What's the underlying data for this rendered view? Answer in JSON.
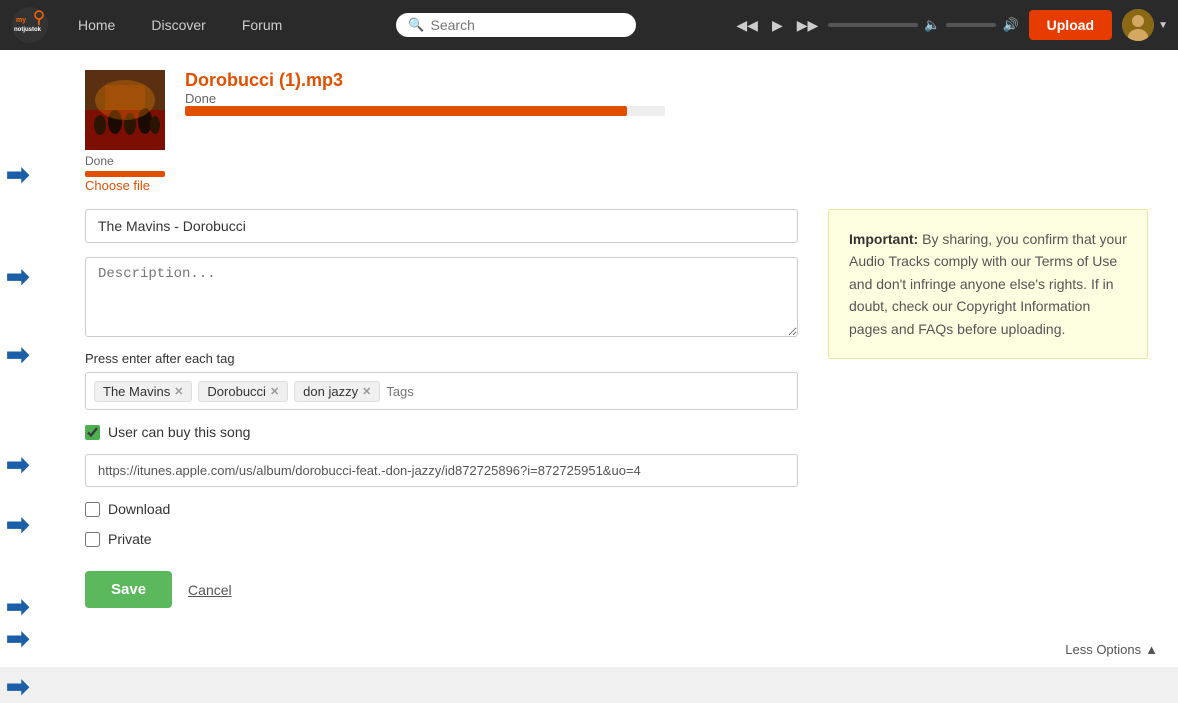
{
  "navbar": {
    "home_label": "Home",
    "discover_label": "Discover",
    "forum_label": "Forum",
    "search_placeholder": "Search",
    "upload_label": "Upload"
  },
  "track": {
    "filename": "Dorobucci (1).mp3",
    "status": "Done",
    "progress_percent": 92,
    "choose_file_label": "Choose file"
  },
  "form": {
    "title_value": "The Mavins - Dorobucci",
    "title_placeholder": "",
    "description_placeholder": "Description...",
    "tags_label": "Press enter after each tag",
    "tags": [
      {
        "label": "The Mavins"
      },
      {
        "label": "Dorobucci"
      },
      {
        "label": "don jazzy"
      }
    ],
    "tags_input_placeholder": "Tags",
    "buy_checkbox_label": "User can buy this song",
    "buy_link_value": "https://itunes.apple.com/us/album/dorobucci-feat.-don-jazzy/id872725896?i=872725951&uo=4",
    "download_label": "Download",
    "private_label": "Private",
    "save_label": "Save",
    "cancel_label": "Cancel",
    "less_options_label": "Less Options"
  },
  "important_box": {
    "bold_text": "Important:",
    "text": " By sharing, you confirm that your Audio Tracks comply with our Terms of Use and don't infringe anyone else's rights. If in doubt, check our Copyright Information pages and FAQs before uploading."
  }
}
